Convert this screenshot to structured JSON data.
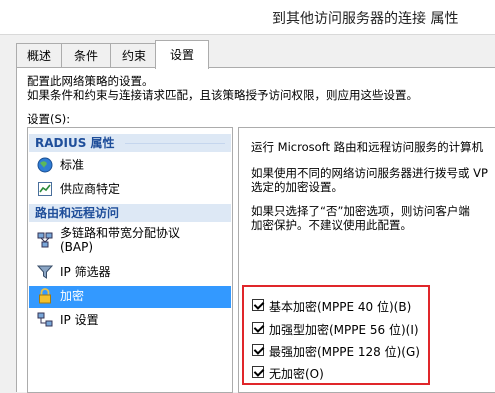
{
  "window": {
    "title": "到其他访问服务器的连接 属性"
  },
  "tabs": [
    {
      "label": "概述"
    },
    {
      "label": "条件"
    },
    {
      "label": "约束"
    },
    {
      "label": "设置"
    }
  ],
  "description": {
    "line1": "配置此网络策略的设置。",
    "line2": "如果条件和约束与连接请求匹配，且该策略授予访问权限，则应用这些设置。"
  },
  "settings_label": "设置(S):",
  "tree": {
    "groups": [
      {
        "header": "RADIUS 属性",
        "items": [
          {
            "label": "标准"
          },
          {
            "label": "供应商特定"
          }
        ]
      },
      {
        "header": "路由和远程访问",
        "items": [
          {
            "label": "多链路和带宽分配协议",
            "label2": "(BAP)"
          },
          {
            "label": "IP 筛选器"
          },
          {
            "label": "加密"
          },
          {
            "label": "IP 设置"
          }
        ]
      }
    ]
  },
  "content": {
    "line1": "运行 Microsoft 路由和远程访问服务的计算机",
    "line2": "如果使用不同的网络访问服务器进行拨号或 VP",
    "line3": "选定的加密设置。",
    "line4": "如果只选择了“否”加密选项，则访问客户端",
    "line5": "加密保护。不建议使用此配置。"
  },
  "encryption_options": [
    {
      "label": "基本加密(MPPE 40 位)(B)",
      "checked": true
    },
    {
      "label": "加强型加密(MPPE 56 位)(I)",
      "checked": true
    },
    {
      "label": "最强加密(MPPE 128 位)(G)",
      "checked": true
    },
    {
      "label": "无加密(O)",
      "checked": true
    }
  ],
  "colors": {
    "selection": "#3399ff",
    "group_header_bg": "#dde8f5",
    "group_header_text": "#1f4e9a",
    "highlight_box": "#e0262a"
  },
  "icons": [
    "globe-icon",
    "vendor-icon",
    "network-icon",
    "funnel-icon",
    "lock-icon",
    "ip-network-icon"
  ]
}
